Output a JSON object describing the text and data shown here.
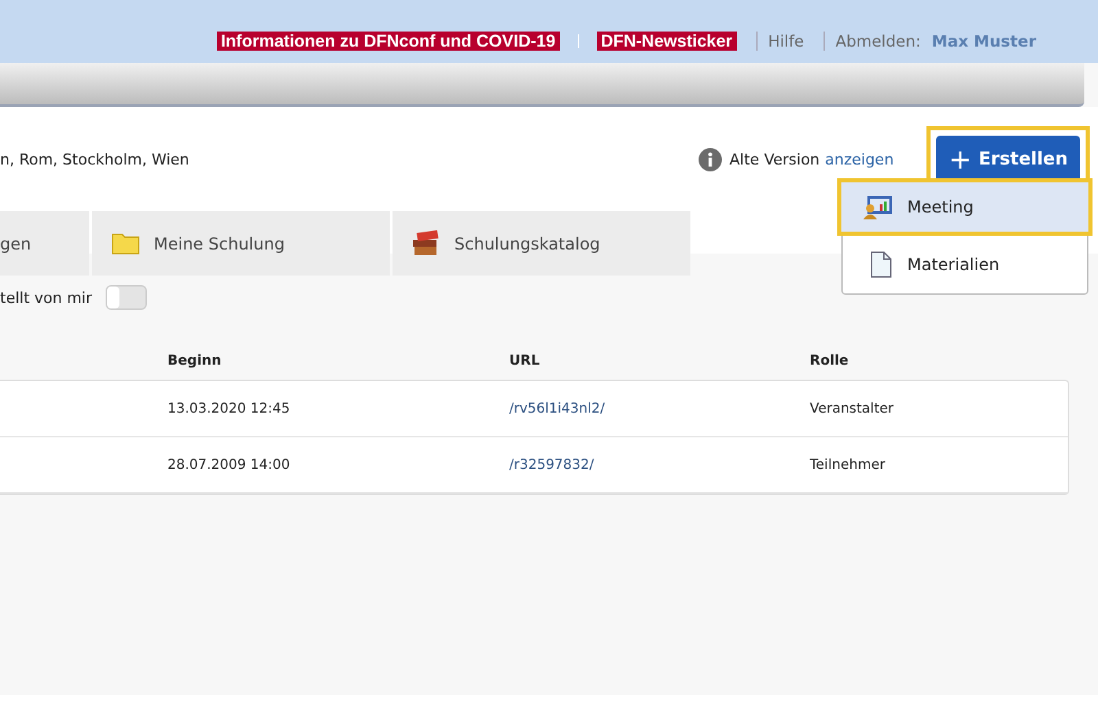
{
  "top_bar": {
    "news": [
      "Informationen zu DFNconf und COVID-19",
      "DFN-Newsticker"
    ],
    "help": "Hilfe",
    "logout_label": "Abmelden:",
    "user": "Max Muster"
  },
  "info": {
    "text": "n, Rom, Stockholm, Wien",
    "old_version": "Alte Version",
    "old_version_link": "anzeigen"
  },
  "create_button": {
    "icon": "+",
    "label": "Erstellen",
    "highlighted": true
  },
  "create_menu": [
    {
      "label": "Meeting",
      "kind": "meeting",
      "selected": true
    },
    {
      "label": "Materialien",
      "kind": "document",
      "selected": false
    }
  ],
  "tabs": [
    {
      "label": "gen",
      "kind": "none",
      "selected": false
    },
    {
      "label": "Meine Schulung",
      "kind": "folder",
      "selected": false
    },
    {
      "label": "Schulungskatalog",
      "kind": "books",
      "selected": false
    }
  ],
  "filter": {
    "label": "tellt von mir",
    "on": false
  },
  "table": {
    "columns": [
      "Beginn",
      "URL",
      "Rolle"
    ],
    "rows": [
      [
        "13.03.2020 12:45",
        "/rv56l1i43nl2/",
        "Veranstalter"
      ],
      [
        "28.07.2009 14:00",
        "/r32597832/",
        "Teilnehmer"
      ]
    ]
  }
}
